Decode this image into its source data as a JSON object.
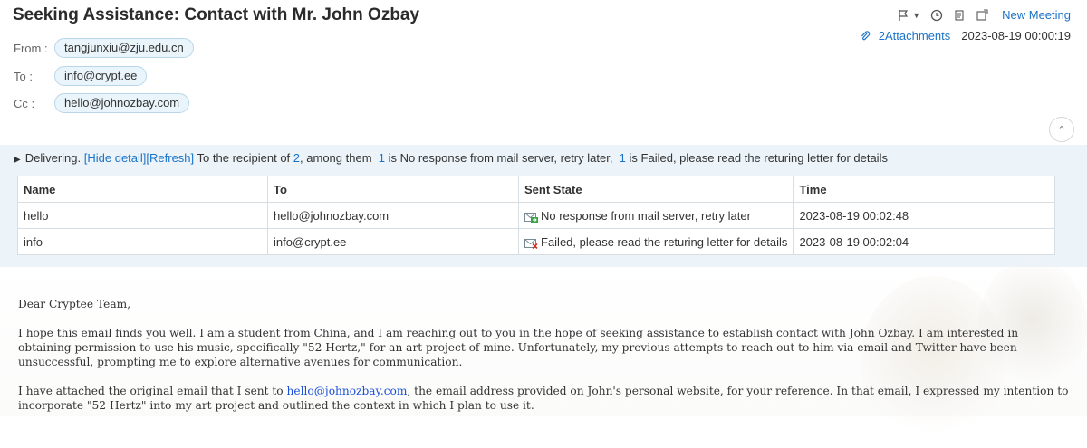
{
  "subject": "Seeking Assistance: Contact with Mr. John Ozbay",
  "toolbar": {
    "icons": [
      "flag-icon",
      "clock-icon",
      "reply-icon",
      "forward-icon"
    ],
    "new_meeting": "New Meeting"
  },
  "attachments_label": "2Attachments",
  "date": "2023-08-19 00:00:19",
  "from": {
    "label": "From :",
    "value": "tangjunxiu@zju.edu.cn"
  },
  "to": {
    "label": "To :",
    "value": "info@crypt.ee"
  },
  "cc": {
    "label": "Cc :",
    "value": "hello@johnozbay.com"
  },
  "delivery": {
    "state": "Delivering.",
    "hide_detail": "[Hide detail]",
    "refresh": "[Refresh]",
    "text1": "To the recipient of",
    "total": "2",
    "text2": ", among them",
    "n1": "1",
    "text3": "is No response from mail server, retry later,",
    "n2": "1",
    "text4": "is Failed, please read the returing letter for details"
  },
  "table": {
    "headers": [
      "Name",
      "To",
      "Sent State",
      "Time"
    ],
    "rows": [
      {
        "name": "hello",
        "to": "hello@johnozbay.com",
        "state": "No response from mail server, retry later",
        "state_icon": "pending-mail-icon",
        "time": "2023-08-19 00:02:48"
      },
      {
        "name": "info",
        "to": "info@crypt.ee",
        "state": "Failed, please read the returing letter for details",
        "state_icon": "failed-mail-icon",
        "time": "2023-08-19 00:02:04"
      }
    ]
  },
  "body": {
    "greeting": "Dear Cryptee Team,",
    "p1": "I hope this email finds you well. I am a student from China, and I am reaching out to you in the hope of seeking assistance to establish contact with John Ozbay. I am interested in obtaining permission to use his music, specifically \"52 Hertz,\" for an art project of mine. Unfortunately, my previous attempts to reach out to him via email and Twitter have been unsuccessful, prompting me to explore alternative avenues for communication.",
    "p2_before": "I have attached the original email that I sent to ",
    "p2_link": "hello@johnozbay.com",
    "p2_after": ", the email address provided on John's personal website, for your reference. In that email, I expressed my intention to incorporate \"52 Hertz\" into my art project and outlined the context in which I plan to use it."
  },
  "colors": {
    "link": "#1a73c8",
    "panel": "#edf4f9",
    "chip_bg": "#eaf4fb",
    "chip_border": "#b8d6ea"
  }
}
